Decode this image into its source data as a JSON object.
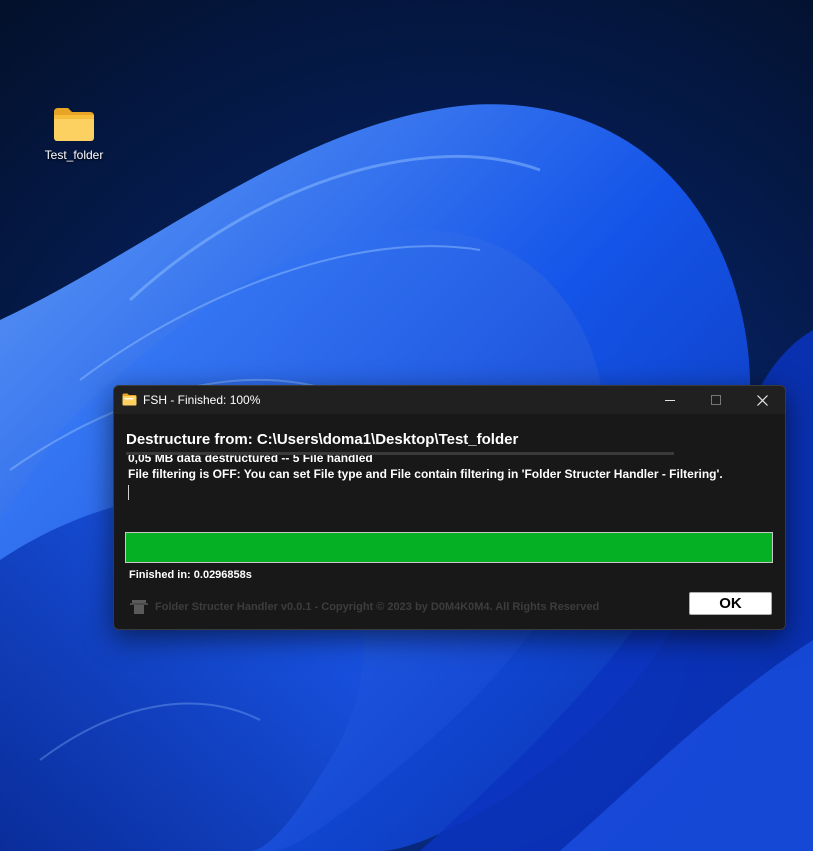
{
  "desktop": {
    "icon": {
      "label": "Test_folder",
      "icon": "folder-icon"
    }
  },
  "window": {
    "title": "FSH - Finished: 100%",
    "icon": "folder-icon",
    "controls": {
      "minimize": "minimize-icon",
      "maximize": "maximize-icon",
      "close": "close-icon"
    },
    "heading": "Destructure from: C:\\Users\\doma1\\Desktop\\Test_folder",
    "log": {
      "line1": "0,05 MB data destructured -- 5 File handled",
      "line2": "File filtering is OFF: You can set File type and File contain filtering in 'Folder Structer Handler - Filtering'."
    },
    "progress": {
      "percent": 100,
      "color": "#06b025"
    },
    "finished": "Finished in: 0.0296858s",
    "copyright": "Folder Structer Handler v0.0.1 - Copyright © 2023 by D0M4K0M4. All Rights Reserved",
    "ok_label": "OK"
  },
  "colors": {
    "window_bg": "#181818",
    "titlebar_bg": "#202020",
    "accent_progress": "#06b025"
  }
}
